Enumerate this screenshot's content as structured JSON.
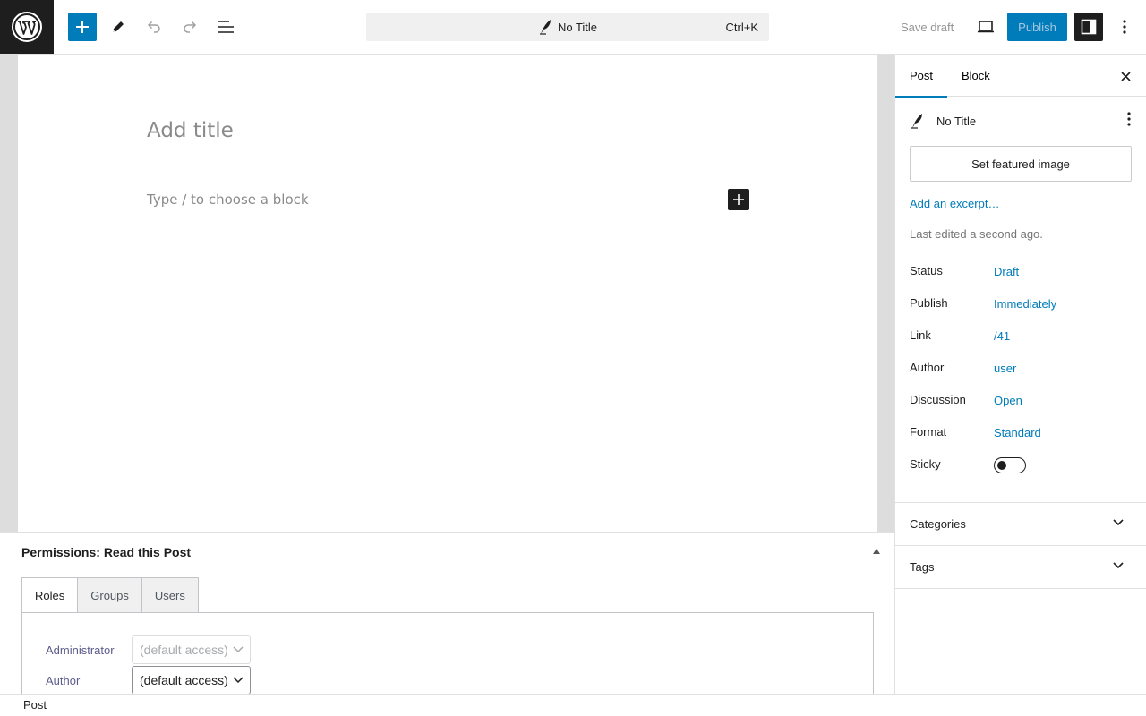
{
  "toolbar": {
    "command_title": "No Title",
    "command_shortcut": "Ctrl+K",
    "save_draft_label": "Save draft",
    "publish_label": "Publish"
  },
  "editor": {
    "title_placeholder": "Add title",
    "block_placeholder": "Type / to choose a block"
  },
  "metabox": {
    "title": "Permissions: Read this Post",
    "tabs": [
      "Roles",
      "Groups",
      "Users"
    ],
    "rows": [
      {
        "label": "Administrator",
        "value": "(default access)",
        "disabled": true
      },
      {
        "label": "Author",
        "value": "(default access)",
        "disabled": false
      }
    ]
  },
  "footer": {
    "breadcrumb": "Post"
  },
  "sidebar": {
    "tabs": [
      "Post",
      "Block"
    ],
    "post_title": "No Title",
    "featured_image_label": "Set featured image",
    "excerpt_link": "Add an excerpt…",
    "last_edited": "Last edited a second ago.",
    "summary": [
      {
        "label": "Status",
        "value": "Draft"
      },
      {
        "label": "Publish",
        "value": "Immediately"
      },
      {
        "label": "Link",
        "value": "/41"
      },
      {
        "label": "Author",
        "value": "user"
      },
      {
        "label": "Discussion",
        "value": "Open"
      },
      {
        "label": "Format",
        "value": "Standard"
      }
    ],
    "sticky_label": "Sticky",
    "sticky_on": false,
    "panels": [
      "Categories",
      "Tags"
    ]
  },
  "colors": {
    "accent": "#007cba",
    "dark": "#1e1e1e",
    "canvas_bg": "#dddddd"
  }
}
